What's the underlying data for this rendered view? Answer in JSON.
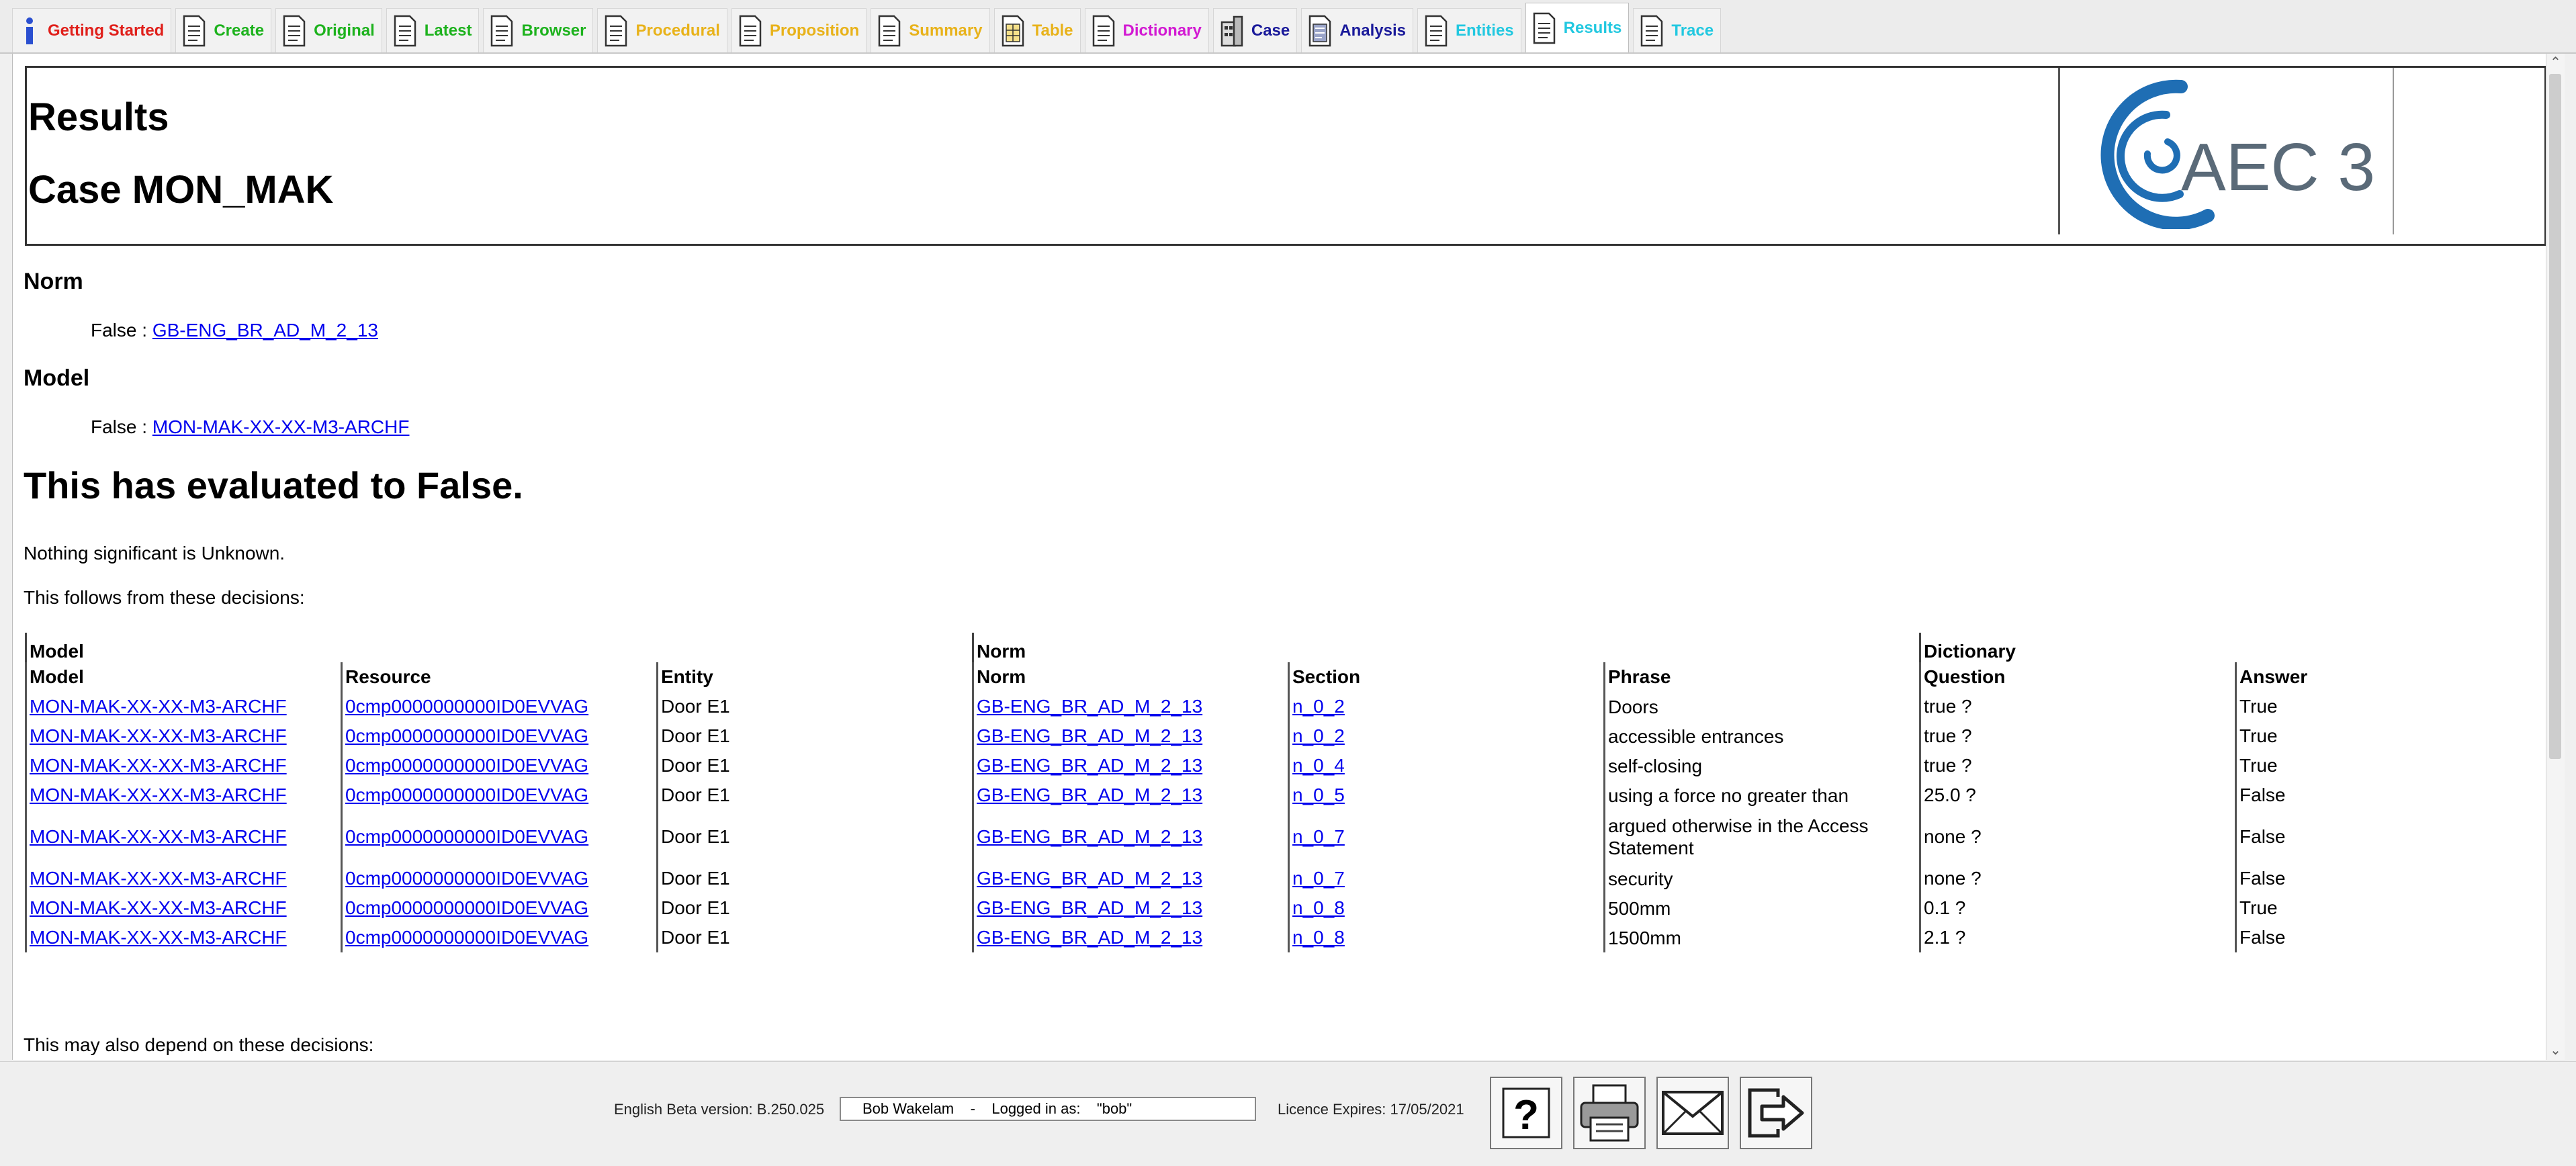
{
  "tabs": [
    {
      "id": "getting-started",
      "label": "Getting Started",
      "color": "#e0201b",
      "icon": "info-icon"
    },
    {
      "id": "create",
      "label": "Create",
      "color": "#1db21d",
      "icon": "document-icon"
    },
    {
      "id": "original",
      "label": "Original",
      "color": "#1db21d",
      "icon": "document-icon"
    },
    {
      "id": "latest",
      "label": "Latest",
      "color": "#1db21d",
      "icon": "document-icon"
    },
    {
      "id": "browser",
      "label": "Browser",
      "color": "#1db21d",
      "icon": "document-icon"
    },
    {
      "id": "procedural",
      "label": "Procedural",
      "color": "#e8b21a",
      "icon": "document-icon"
    },
    {
      "id": "proposition",
      "label": "Proposition",
      "color": "#e8b21a",
      "icon": "document-icon"
    },
    {
      "id": "summary",
      "label": "Summary",
      "color": "#e8b21a",
      "icon": "document-icon"
    },
    {
      "id": "table",
      "label": "Table",
      "color": "#e8b21a",
      "icon": "table-document-icon"
    },
    {
      "id": "dictionary",
      "label": "Dictionary",
      "color": "#d21ad2",
      "icon": "document-icon"
    },
    {
      "id": "case",
      "label": "Case",
      "color": "#1a1a9a",
      "icon": "building-icon"
    },
    {
      "id": "analysis",
      "label": "Analysis",
      "color": "#1a1a9a",
      "icon": "analysis-document-icon"
    },
    {
      "id": "entities",
      "label": "Entities",
      "color": "#22c8e0",
      "icon": "document-icon"
    },
    {
      "id": "results",
      "label": "Results",
      "color": "#22c8e0",
      "icon": "document-icon",
      "active": true
    },
    {
      "id": "trace",
      "label": "Trace",
      "color": "#22c8e0",
      "icon": "document-icon"
    }
  ],
  "header": {
    "title": "Results",
    "case_title": "Case MON_MAK",
    "logo_text": "AEC 3",
    "logo_color": "#1f6eb4"
  },
  "norm": {
    "heading": "Norm",
    "prefix": "False : ",
    "link": "GB-ENG_BR_AD_M_2_13"
  },
  "model": {
    "heading": "Model",
    "prefix": "False : ",
    "link": "MON-MAK-XX-XX-M3-ARCHF"
  },
  "verdict": "This has evaluated to False.",
  "unknown_text": "Nothing significant is Unknown.",
  "follows_text": "This follows from these decisions:",
  "also_text": "This may also depend on these decisions:",
  "table": {
    "groups": {
      "model": "Model",
      "norm": "Norm",
      "dictionary": "Dictionary"
    },
    "columns": [
      "Model",
      "Resource",
      "Entity",
      "Norm",
      "Section",
      "Phrase",
      "Question",
      "Answer"
    ],
    "rows": [
      {
        "model": "MON-MAK-XX-XX-M3-ARCHF",
        "resource": "0cmp0000000000ID0EVVAG",
        "entity": "Door E1",
        "norm": "GB-ENG_BR_AD_M_2_13",
        "section": "n_0_2",
        "phrase": "Doors",
        "question": "true ?",
        "answer": "True"
      },
      {
        "model": "MON-MAK-XX-XX-M3-ARCHF",
        "resource": "0cmp0000000000ID0EVVAG",
        "entity": "Door E1",
        "norm": "GB-ENG_BR_AD_M_2_13",
        "section": "n_0_2",
        "phrase": "accessible entrances",
        "question": "true ?",
        "answer": "True"
      },
      {
        "model": "MON-MAK-XX-XX-M3-ARCHF",
        "resource": "0cmp0000000000ID0EVVAG",
        "entity": "Door E1",
        "norm": "GB-ENG_BR_AD_M_2_13",
        "section": "n_0_4",
        "phrase": "self-closing",
        "question": "true ?",
        "answer": "True"
      },
      {
        "model": "MON-MAK-XX-XX-M3-ARCHF",
        "resource": "0cmp0000000000ID0EVVAG",
        "entity": "Door E1",
        "norm": "GB-ENG_BR_AD_M_2_13",
        "section": "n_0_5",
        "phrase": "using a force no greater than",
        "question": "25.0 ?",
        "answer": "False"
      },
      {
        "model": "MON-MAK-XX-XX-M3-ARCHF",
        "resource": "0cmp0000000000ID0EVVAG",
        "entity": "Door E1",
        "norm": "GB-ENG_BR_AD_M_2_13",
        "section": "n_0_7",
        "phrase": "argued otherwise in the Access Statement",
        "question": "none ?",
        "answer": "False",
        "tall": true
      },
      {
        "model": "MON-MAK-XX-XX-M3-ARCHF",
        "resource": "0cmp0000000000ID0EVVAG",
        "entity": "Door E1",
        "norm": "GB-ENG_BR_AD_M_2_13",
        "section": "n_0_7",
        "phrase": "security",
        "question": "none ?",
        "answer": "False"
      },
      {
        "model": "MON-MAK-XX-XX-M3-ARCHF",
        "resource": "0cmp0000000000ID0EVVAG",
        "entity": "Door E1",
        "norm": "GB-ENG_BR_AD_M_2_13",
        "section": "n_0_8",
        "phrase": "500mm",
        "question": "0.1 ?",
        "answer": "True"
      },
      {
        "model": "MON-MAK-XX-XX-M3-ARCHF",
        "resource": "0cmp0000000000ID0EVVAG",
        "entity": "Door E1",
        "norm": "GB-ENG_BR_AD_M_2_13",
        "section": "n_0_8",
        "phrase": "1500mm",
        "question": "2.1 ?",
        "answer": "False"
      }
    ]
  },
  "footer": {
    "version": "English Beta version: B.250.025",
    "user": "Bob Wakelam    -    Logged in as:    \"bob\"",
    "licence": "Licence Expires: 17/05/2021",
    "buttons": [
      {
        "id": "help",
        "icon": "help-icon"
      },
      {
        "id": "print",
        "icon": "printer-icon"
      },
      {
        "id": "email",
        "icon": "email-icon"
      },
      {
        "id": "logout",
        "icon": "logout-icon"
      }
    ]
  }
}
